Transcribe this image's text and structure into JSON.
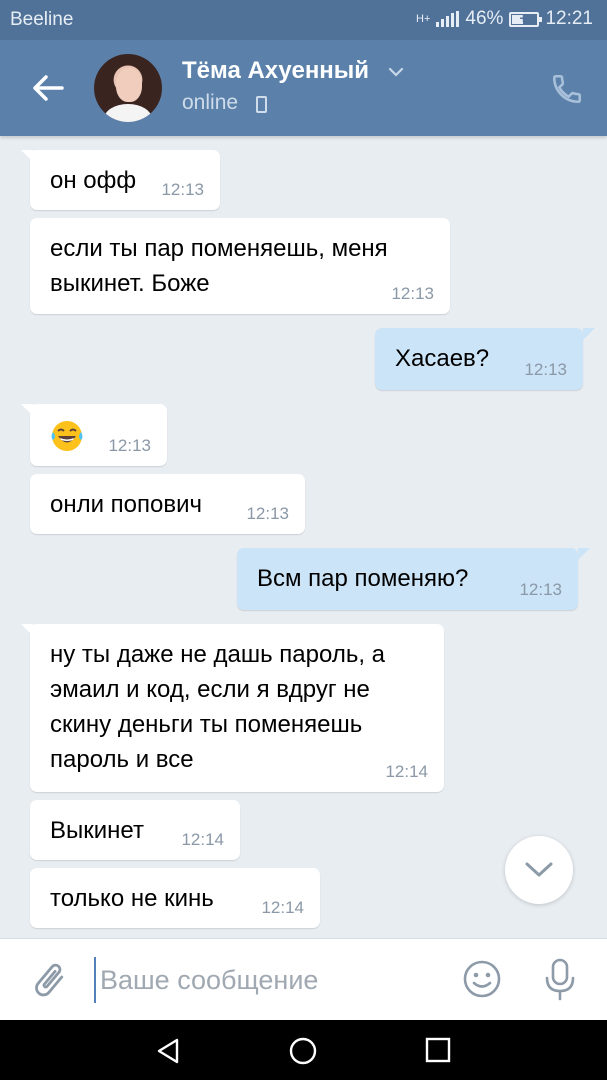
{
  "status_bar": {
    "carrier": "Beeline",
    "network": "H+",
    "battery_percent": "46%",
    "battery_level": 0.46,
    "time": "12:21"
  },
  "header": {
    "contact_name": "Тёма Ахуенный",
    "contact_status": "online"
  },
  "messages": [
    {
      "direction": "in",
      "text": "он офф",
      "time": "12:13"
    },
    {
      "direction": "in",
      "text": "если ты пар поменяешь, меня выкинет. Боже",
      "time": "12:13"
    },
    {
      "direction": "out",
      "text": "Хасаев?",
      "time": "12:13"
    },
    {
      "direction": "in",
      "text": "😂",
      "time": "12:13"
    },
    {
      "direction": "in",
      "text": "онли попович",
      "time": "12:13"
    },
    {
      "direction": "out",
      "text": "Всм пар поменяю?",
      "time": "12:13"
    },
    {
      "direction": "in",
      "text": "ну ты даже не дашь пароль, а эмаил и код, если я вдруг не скину деньги ты поменяешь пароль и все",
      "time": "12:14"
    },
    {
      "direction": "in",
      "text": "Выкинет",
      "time": "12:14"
    },
    {
      "direction": "in",
      "text": "только не кинь",
      "time": "12:14"
    }
  ],
  "composer": {
    "placeholder": "Ваше сообщение"
  },
  "colors": {
    "header": "#5b81ab",
    "status_bar": "#507299",
    "chat_background": "#e8edf2",
    "incoming_bubble": "#ffffff",
    "outgoing_bubble": "#cce4f7",
    "icon_gray": "#8d9aa8"
  },
  "icons": {
    "back": "arrow-left",
    "call": "phone",
    "attach": "paperclip",
    "emoji": "smiley",
    "mic": "microphone",
    "scroll_down": "chevron-down"
  }
}
